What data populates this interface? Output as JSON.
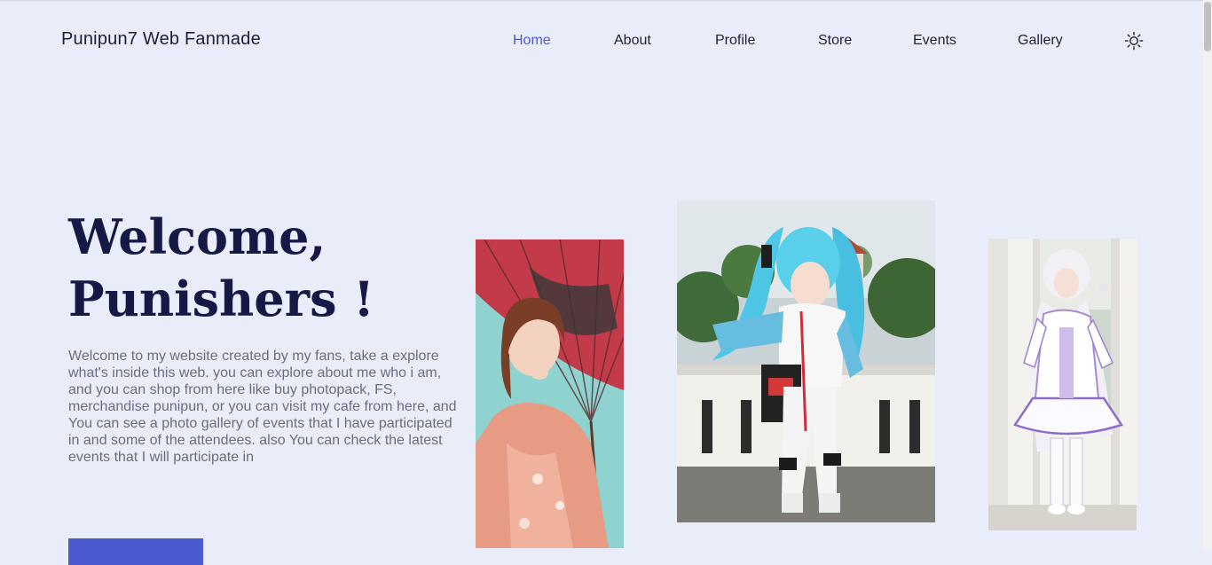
{
  "header": {
    "brand": "Punipun7 Web Fanmade",
    "nav": [
      "Home",
      "About",
      "Profile",
      "Store",
      "Events",
      "Gallery"
    ],
    "active_nav": "Home",
    "theme_icon": "sun-icon"
  },
  "hero": {
    "title_line1": "Welcome,",
    "title_line2": "Punishers !",
    "description": "Welcome to my website created by my fans, take a explore what's inside this web. you can explore about me who i am, and you can shop from here like buy photopack, FS, merchandise punipun, or you can visit my cafe from here, and You can see a photo gallery of events that I have participated in and some of the attendees. also You can check the latest events that I will participate in"
  },
  "colors": {
    "background": "#e9ecf9",
    "accent": "#4a5bd0",
    "title": "#141a45",
    "body_text": "#6b6e7d"
  }
}
